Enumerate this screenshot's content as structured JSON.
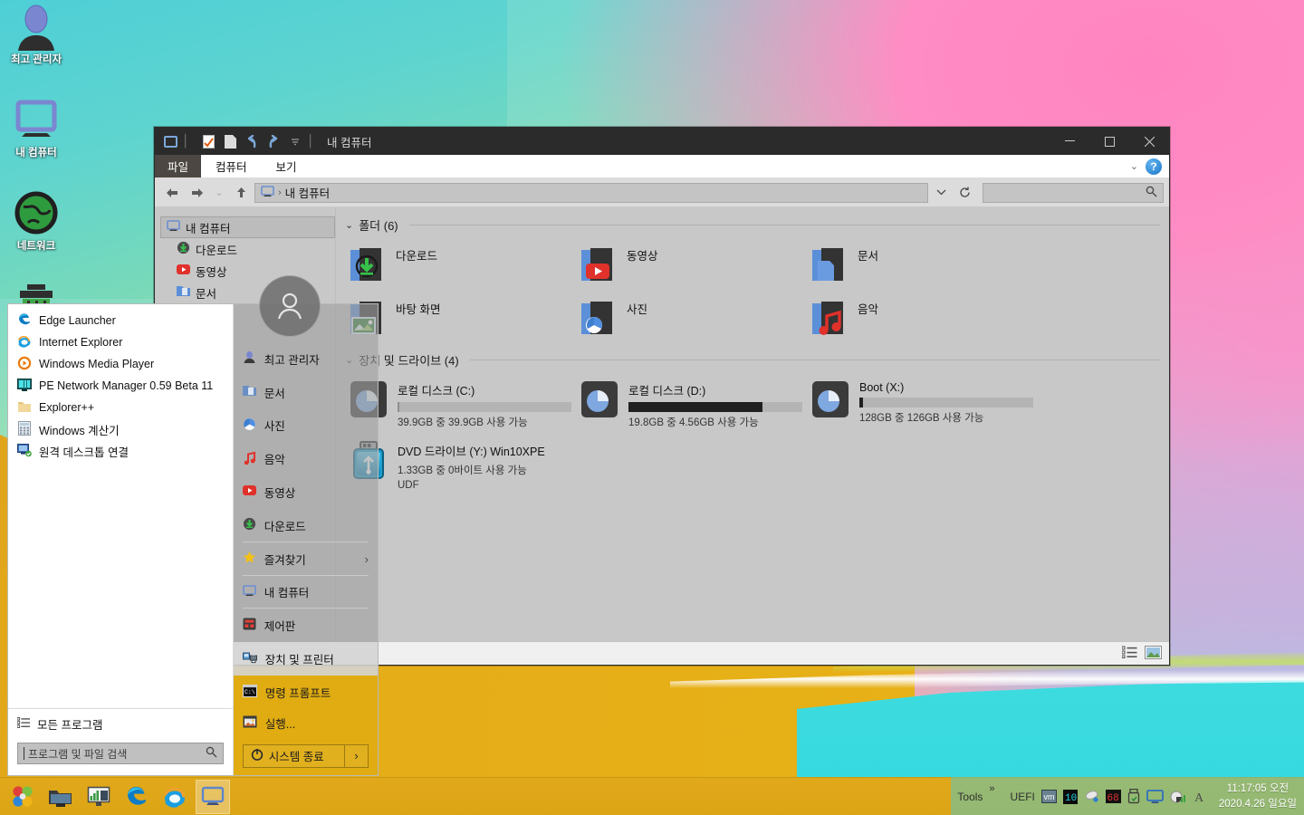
{
  "desktop": {
    "icons": [
      {
        "name": "user-icon",
        "label": "최고 관리자"
      },
      {
        "name": "my-computer-icon",
        "label": "내 컴퓨터"
      },
      {
        "name": "network-icon",
        "label": "네트워크"
      },
      {
        "name": "recycle-bin-icon",
        "label": ""
      }
    ]
  },
  "explorer": {
    "title": "내 컴퓨터",
    "quick_access": [
      "window-icon",
      "properties-icon",
      "new-folder-icon",
      "undo-icon",
      "redo-icon",
      "customize-icon"
    ],
    "window_buttons": {
      "minimize": "—",
      "maximize": "❐",
      "close": "✕"
    },
    "tabs": [
      {
        "label": "파일"
      },
      {
        "label": "컴퓨터"
      },
      {
        "label": "보기"
      }
    ],
    "ribbon_collapse": "⌄",
    "help_label": "?",
    "address": {
      "back": "←",
      "forward": "→",
      "recent": "⌄",
      "up": "↑",
      "crumb_root_icon": "computer-icon",
      "crumb": "내 컴퓨터",
      "crumb_sep": "›",
      "dropdown": "⌄",
      "refresh": "↻"
    },
    "search": {
      "value": "",
      "placeholder": ""
    },
    "navpane": [
      {
        "label": "내 컴퓨터",
        "icon": "computer-icon",
        "selected": true
      },
      {
        "label": "다운로드",
        "icon": "downloads-icon",
        "selected": false
      },
      {
        "label": "동영상",
        "icon": "videos-icon",
        "selected": false
      },
      {
        "label": "문서",
        "icon": "documents-icon",
        "selected": false
      }
    ],
    "groups": [
      {
        "title": "폴더 (6)",
        "items": [
          {
            "label": "다운로드",
            "icon": "folder-downloads-icon"
          },
          {
            "label": "동영상",
            "icon": "folder-videos-icon"
          },
          {
            "label": "문서",
            "icon": "folder-documents-icon"
          },
          {
            "label": "바탕 화면",
            "icon": "folder-desktop-icon"
          },
          {
            "label": "사진",
            "icon": "folder-pictures-icon"
          },
          {
            "label": "음악",
            "icon": "folder-music-icon"
          }
        ]
      },
      {
        "title": "장치 및 드라이브 (4)",
        "drives": [
          {
            "label": "로컬 디스크 (C:)",
            "meta": "39.9GB 중 39.9GB 사용 가능",
            "used_pct": 0,
            "icon": "hard-drive-icon",
            "bar_style": "gray"
          },
          {
            "label": "로컬 디스크 (D:)",
            "meta": "19.8GB 중 4.56GB 사용 가능",
            "used_pct": 77,
            "icon": "hard-drive-icon",
            "bar_style": "dark"
          },
          {
            "label": "Boot (X:)",
            "meta": "128GB 중 126GB 사용 가능",
            "used_pct": 2,
            "icon": "hard-drive-icon",
            "bar_style": "dark"
          },
          {
            "label": "DVD 드라이브 (Y:) Win10XPE",
            "meta": "1.33GB 중 0바이트 사용 가능",
            "meta2": "UDF",
            "used_pct": 100,
            "icon": "usb-drive-icon",
            "bar_style": "none"
          }
        ]
      }
    ],
    "status": {
      "details_view": "details-view-icon",
      "large_icons_view": "large-icons-view-icon"
    }
  },
  "start_menu": {
    "programs": [
      {
        "label": "Edge Launcher",
        "icon": "edge-icon"
      },
      {
        "label": "Internet Explorer",
        "icon": "ie-icon"
      },
      {
        "label": "Windows Media Player",
        "icon": "wmp-icon"
      },
      {
        "label": "PE Network Manager 0.59 Beta 11",
        "icon": "network-manager-icon"
      },
      {
        "label": "Explorer++",
        "icon": "explorer-plus-icon"
      },
      {
        "label": "Windows 계산기",
        "icon": "calculator-icon"
      },
      {
        "label": "원격 데스크톱 연결",
        "icon": "remote-desktop-icon"
      }
    ],
    "all_programs": {
      "label": "모든 프로그램",
      "icon": "all-programs-icon"
    },
    "search": {
      "placeholder": "프로그램 및 파일 검색",
      "value": "",
      "icon": "search-icon"
    },
    "right_items": [
      {
        "label": "최고 관리자",
        "icon": "user-icon",
        "highlight": false
      },
      {
        "label": "문서",
        "icon": "documents-icon",
        "highlight": false
      },
      {
        "label": "사진",
        "icon": "pictures-icon",
        "highlight": false
      },
      {
        "label": "음악",
        "icon": "music-icon",
        "highlight": false
      },
      {
        "label": "동영상",
        "icon": "videos-icon",
        "highlight": false
      },
      {
        "label": "다운로드",
        "icon": "downloads-icon",
        "highlight": false
      },
      {
        "label": "즐겨찾기",
        "icon": "favorites-icon",
        "arrow": "›",
        "highlight": false
      },
      {
        "label": "내 컴퓨터",
        "icon": "computer-icon",
        "highlight": false
      },
      {
        "label": "제어판",
        "icon": "control-panel-icon",
        "highlight": false
      },
      {
        "label": "장치 및 프린터",
        "icon": "devices-printers-icon",
        "highlight": true
      }
    ],
    "bottom_items": [
      {
        "label": "명령 프롬프트",
        "icon": "command-prompt-icon"
      },
      {
        "label": "실행...",
        "icon": "run-icon"
      }
    ],
    "shutdown": {
      "label": "시스템 종료",
      "icon": "power-icon",
      "more": "›"
    }
  },
  "taskbar": {
    "buttons": [
      {
        "name": "start-button",
        "icon": "windows-flower-icon"
      },
      {
        "name": "taskbar-explorer-shortcut",
        "icon": "folder-network-icon"
      },
      {
        "name": "taskbar-network-monitor",
        "icon": "network-monitor-icon"
      },
      {
        "name": "taskbar-edge",
        "icon": "edge-icon"
      },
      {
        "name": "taskbar-ie",
        "icon": "ie-icon"
      },
      {
        "name": "taskbar-my-computer",
        "icon": "computer-icon",
        "active": true
      }
    ],
    "tray": {
      "tools_label": "Tools",
      "overflow": "»",
      "uefi_label": "UEFI",
      "icons": [
        "vm-icon",
        "segment-display-icon",
        "mouse-icon",
        "temperature-icon",
        "usb-eject-icon",
        "display-icon",
        "volume-icon",
        "ime-icon"
      ],
      "clock_time": "11:17:05 오전",
      "clock_date": "2020.4.26 일요일"
    }
  },
  "colors": {
    "taskbar": "#e0a81a",
    "titlebar": "#2b2b2b",
    "window_body": "#c8c8c8",
    "accent_blue": "#1876c8"
  }
}
